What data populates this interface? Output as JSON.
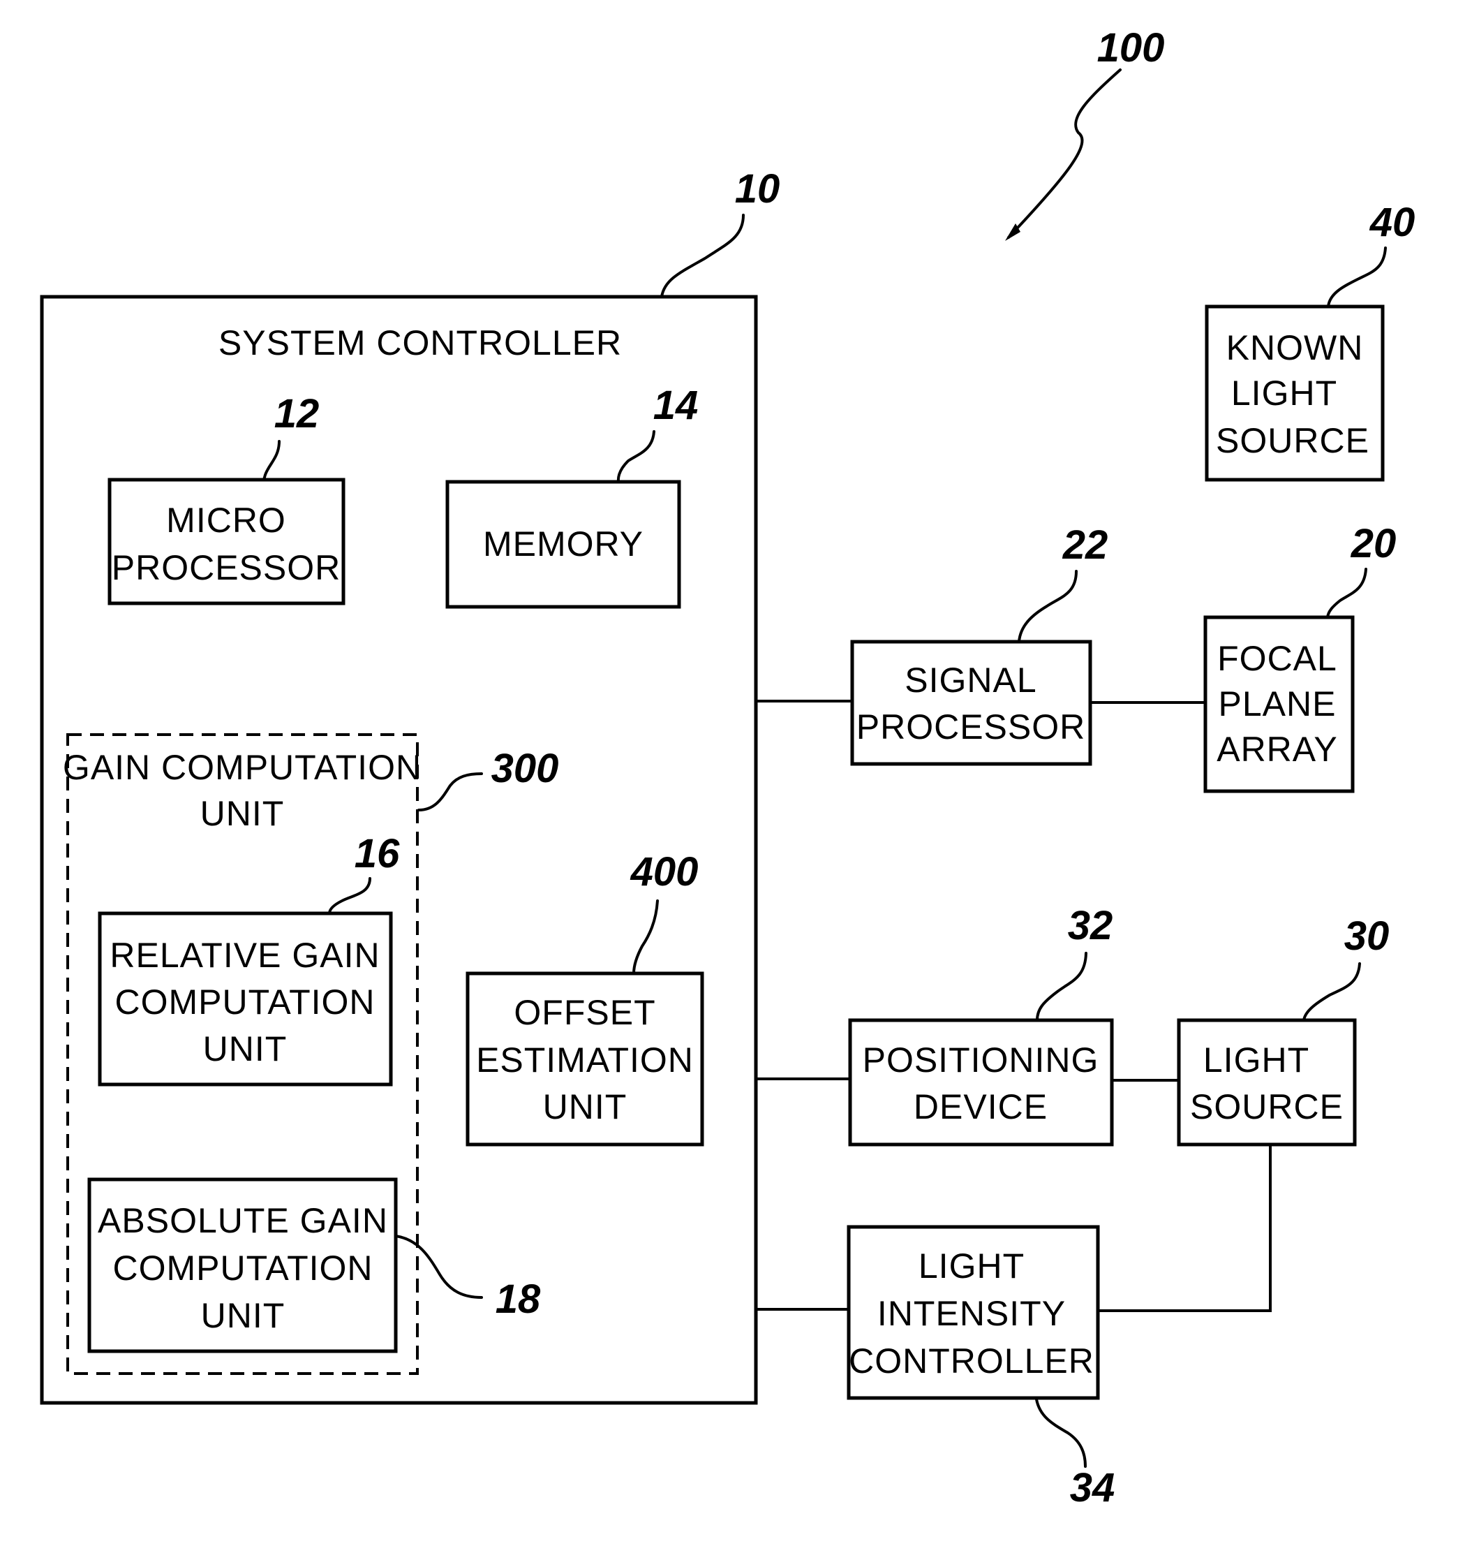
{
  "figure": {
    "reference": "100",
    "system_controller": {
      "ref": "10",
      "title": "SYSTEM CONTROLLER",
      "microprocessor": {
        "ref": "12",
        "lines": [
          "MICRO",
          "PROCESSOR"
        ]
      },
      "memory": {
        "ref": "14",
        "lines": [
          "MEMORY"
        ]
      },
      "gain_computation_unit": {
        "ref": "300",
        "lines": [
          "GAIN COMPUTATION",
          "UNIT"
        ],
        "relative_gain": {
          "ref": "16",
          "lines": [
            "RELATIVE GAIN",
            "COMPUTATION",
            "UNIT"
          ]
        },
        "absolute_gain": {
          "ref": "18",
          "lines": [
            "ABSOLUTE GAIN",
            "COMPUTATION",
            "UNIT"
          ]
        }
      },
      "offset_estimation": {
        "ref": "400",
        "lines": [
          "OFFSET",
          "ESTIMATION",
          "UNIT"
        ]
      }
    },
    "signal_processor": {
      "ref": "22",
      "lines": [
        "SIGNAL",
        "PROCESSOR"
      ]
    },
    "focal_plane_array": {
      "ref": "20",
      "lines": [
        "FOCAL",
        "PLANE",
        "ARRAY"
      ]
    },
    "known_light_source": {
      "ref": "40",
      "lines": [
        "KNOWN",
        "LIGHT",
        "SOURCE"
      ]
    },
    "positioning_device": {
      "ref": "32",
      "lines": [
        "POSITIONING",
        "DEVICE"
      ]
    },
    "light_source": {
      "ref": "30",
      "lines": [
        "LIGHT",
        "SOURCE"
      ]
    },
    "light_intensity_controller": {
      "ref": "34",
      "lines": [
        "LIGHT",
        "INTENSITY",
        "CONTROLLER"
      ]
    }
  }
}
